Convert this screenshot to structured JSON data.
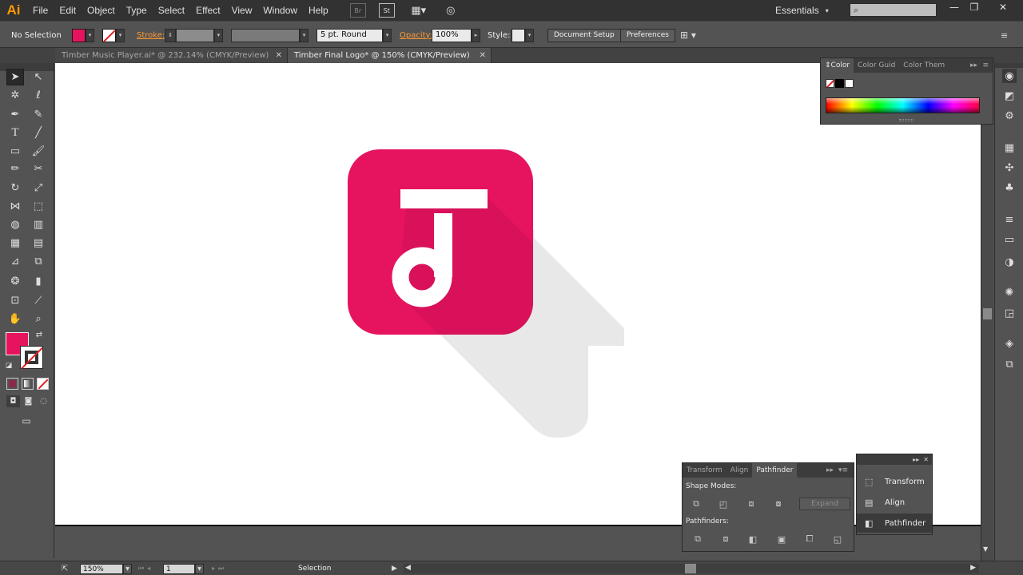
{
  "app": {
    "logo": "Ai"
  },
  "menu": [
    "File",
    "Edit",
    "Object",
    "Type",
    "Select",
    "Effect",
    "View",
    "Window",
    "Help"
  ],
  "menu_icons": {
    "bridge": "Br",
    "stock": "St"
  },
  "workspace": {
    "label": "Essentials"
  },
  "window_controls": {
    "minimize": "—",
    "restore": "❐",
    "close": "✕"
  },
  "control_bar": {
    "selection_label": "No Selection",
    "stroke_label": "Stroke:",
    "brush_value": "5 pt. Round",
    "opacity_label": "Opacity:",
    "opacity_value": "100%",
    "style_label": "Style:",
    "document_setup": "Document Setup",
    "preferences": "Preferences"
  },
  "tabs": [
    {
      "label": "Timber Music Player.ai* @ 232.14% (CMYK/Preview)",
      "close": "✕"
    },
    {
      "label": "Timber Final Logo* @ 150% (CMYK/Preview)",
      "close": "✕"
    }
  ],
  "color_panel": {
    "tabs": [
      "Color",
      "Color Guid",
      "Color Them"
    ],
    "menu": "▸▸"
  },
  "pathfinder_panel": {
    "tabs": [
      "Transform",
      "Align",
      "Pathfinder"
    ],
    "shape_modes_label": "Shape Modes:",
    "pathfinders_label": "Pathfinders:",
    "expand_label": "Expand"
  },
  "collapsed_panels": {
    "items": [
      "Transform",
      "Align",
      "Pathfinder"
    ]
  },
  "status_bar": {
    "zoom": "150%",
    "artboard": "1",
    "tool": "Selection"
  },
  "colors": {
    "logo_pink": "#e6135f",
    "shadow": "#e8e8e8",
    "ui_dark": "#323232",
    "ui_mid": "#535353",
    "accent_orange": "#ff9a00"
  }
}
